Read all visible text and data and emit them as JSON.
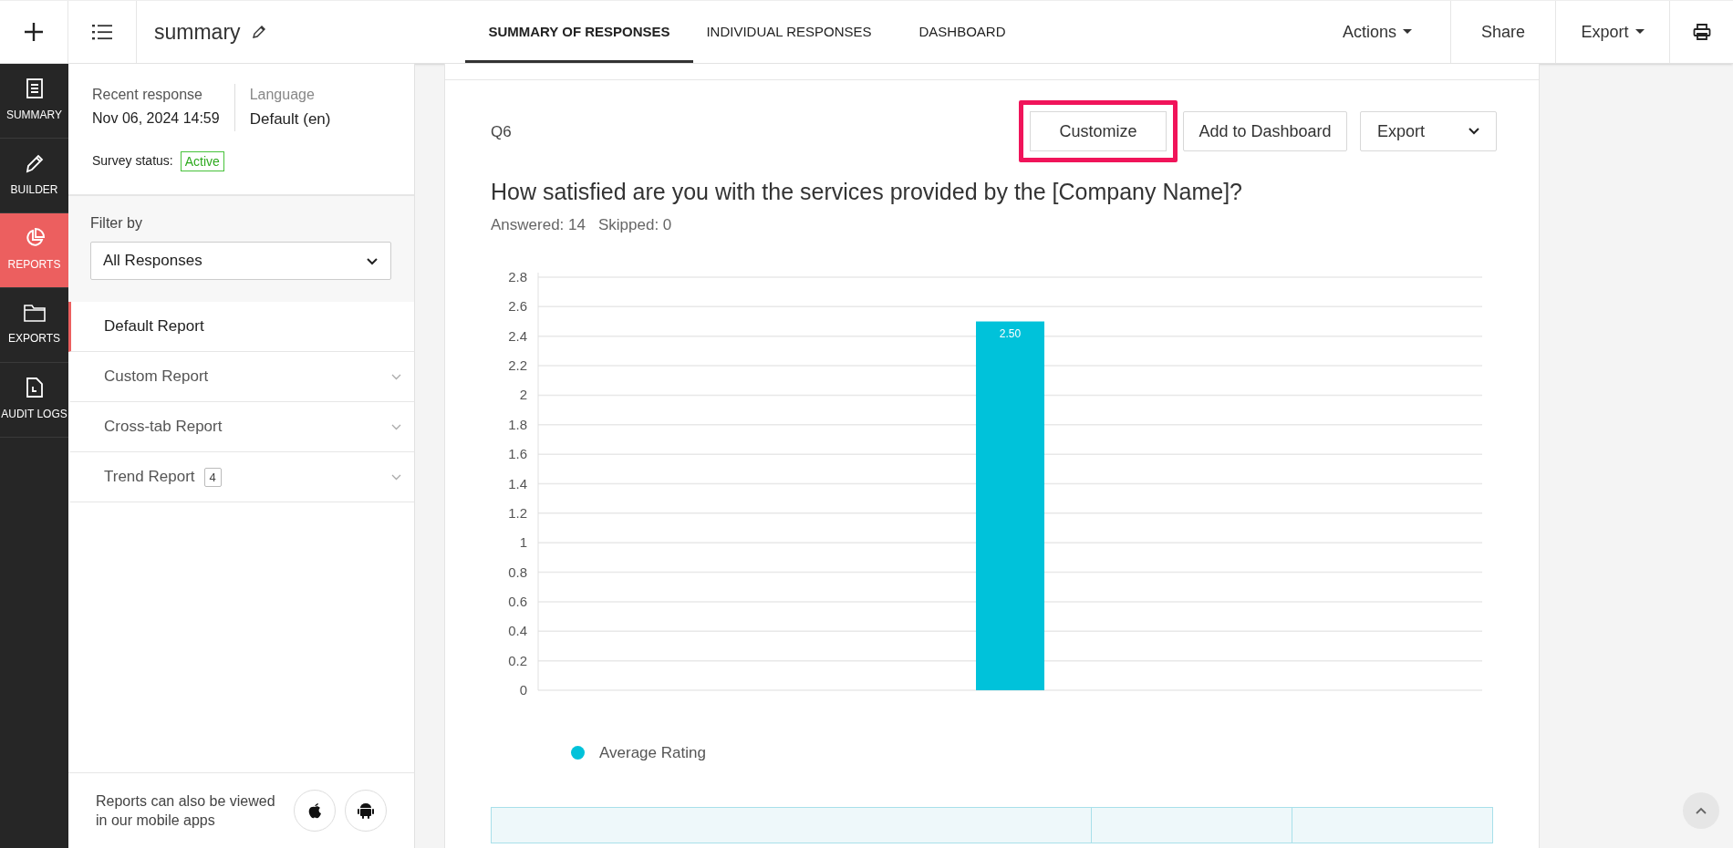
{
  "topbar": {
    "title": "summary",
    "tabs": [
      {
        "label": "SUMMARY OF RESPONSES",
        "selected": true
      },
      {
        "label": "INDIVIDUAL RESPONSES",
        "selected": false
      },
      {
        "label": "DASHBOARD",
        "selected": false
      }
    ],
    "actions": [
      {
        "label": "Actions",
        "kind": "dropdown"
      },
      {
        "label": "Share",
        "kind": "plain"
      },
      {
        "label": "Export",
        "kind": "dropdown"
      },
      {
        "kind": "print"
      }
    ]
  },
  "nav_rail": [
    {
      "label": "SUMMARY",
      "kind": "summary",
      "selected": false
    },
    {
      "label": "BUILDER",
      "kind": "builder",
      "selected": false
    },
    {
      "label": "REPORTS",
      "kind": "reports",
      "selected": true
    },
    {
      "label": "EXPORTS",
      "kind": "exports",
      "selected": false
    },
    {
      "label": "AUDIT LOGS",
      "kind": "audit",
      "selected": false
    }
  ],
  "sidebar": {
    "recent_label": "Recent response",
    "recent_value": "Nov 06, 2024 14:59",
    "language_label": "Language",
    "language_value": "Default (en)",
    "status_label": "Survey status:",
    "status_value": "Active",
    "filter_label": "Filter by",
    "filter_value": "All Responses",
    "reports": [
      {
        "label": "Default Report",
        "selected": true,
        "expandable": false
      },
      {
        "label": "Custom Report",
        "selected": false,
        "expandable": true
      },
      {
        "label": "Cross-tab Report",
        "selected": false,
        "expandable": true
      },
      {
        "label": "Trend Report",
        "badge": "4",
        "selected": false,
        "expandable": true
      }
    ],
    "footer": "Reports can also be viewed in our mobile apps"
  },
  "question": {
    "number": "Q6",
    "buttons": [
      {
        "label": "Customize",
        "highlighted": true,
        "kind": "plain"
      },
      {
        "label": "Add to Dashboard",
        "highlighted": false,
        "kind": "plain"
      },
      {
        "label": "Export",
        "highlighted": false,
        "kind": "dropdown"
      }
    ],
    "text": "How satisfied are you with the services provided by the [Company Name]?",
    "answered": "Answered: 14",
    "skipped": "Skipped: 0",
    "chart_data": {
      "type": "bar",
      "series": [
        {
          "name": "Average Rating",
          "color": "#00c2da",
          "values": [
            2.5
          ]
        }
      ],
      "ylim": [
        0,
        2.8
      ],
      "yticks": [
        0,
        0.2,
        0.4,
        0.6,
        0.8,
        1,
        1.2,
        1.4,
        1.6,
        1.8,
        2,
        2.2,
        2.4,
        2.6,
        2.8
      ],
      "grid": true,
      "value_labels": [
        "2.50"
      ]
    }
  }
}
